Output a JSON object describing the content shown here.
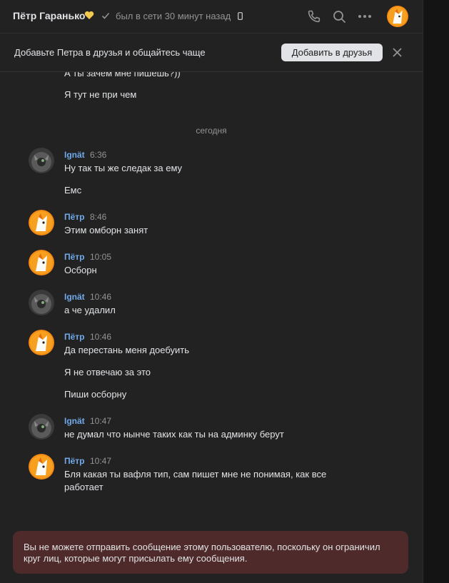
{
  "header": {
    "name": "Пётр Гаранько",
    "status": "был в сети 30 минут назад"
  },
  "friend_bar": {
    "text": "Добавьте Петра в друзья и общайтесь чаще",
    "button_label": "Добавить в друзья"
  },
  "earlier_messages": [
    {
      "text": "А ты зачем мне пишешь?))"
    },
    {
      "text": "Я тут не при чем"
    }
  ],
  "date_separator": "сегодня",
  "messages": [
    {
      "author": "Ignät",
      "time": "6:36",
      "lines": [
        "Ну так ты же следак за ему",
        "Емс"
      ]
    },
    {
      "author": "Пётр",
      "time": "8:46",
      "lines": [
        "Этим омборн занят"
      ]
    },
    {
      "author": "Пётр",
      "time": "10:05",
      "lines": [
        "Осборн"
      ]
    },
    {
      "author": "Ignät",
      "time": "10:46",
      "lines": [
        "а че удалил"
      ]
    },
    {
      "author": "Пётр",
      "time": "10:46",
      "lines": [
        "Да перестань меня доебуить",
        "Я не отвечаю за это",
        "Пиши осборну"
      ]
    },
    {
      "author": "Ignät",
      "time": "10:47",
      "lines": [
        "не думал что нынче таких как ты на админку берут"
      ]
    },
    {
      "author": "Пётр",
      "time": "10:47",
      "lines": [
        "Бля какая ты вафля тип, сам пишет мне не понимая, как все",
        "работает"
      ]
    }
  ],
  "notice": "Вы не можете отправить сообщение этому пользователю, поскольку он ограничил круг лиц, которые могут присылать ему сообщения.",
  "colors": {
    "background": "#222222",
    "author_link": "#71aaeb",
    "notice_bg": "#4f2a2a",
    "muted": "#939393"
  },
  "icons": [
    "heart-icon",
    "check-icon",
    "phone-small-icon",
    "call-icon",
    "search-icon",
    "more-icon",
    "close-icon"
  ]
}
